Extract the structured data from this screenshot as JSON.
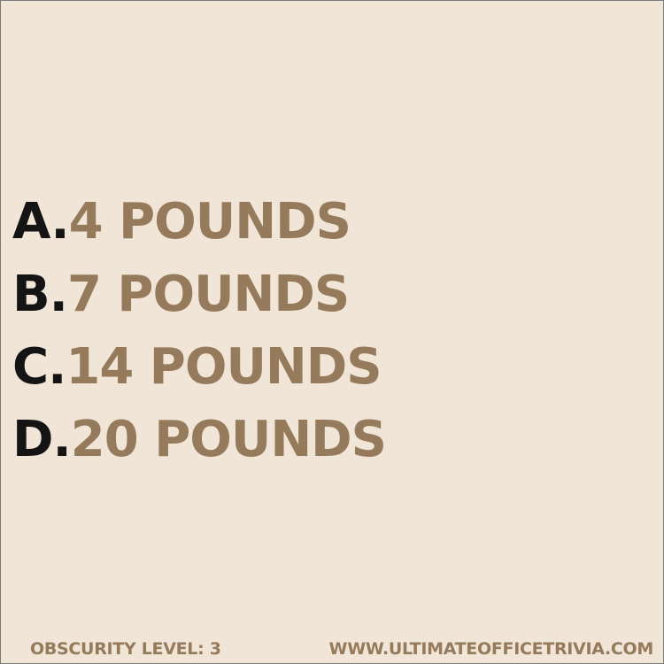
{
  "answers": [
    {
      "letter": "A.",
      "text": "4 POUNDS"
    },
    {
      "letter": "B.",
      "text": "7 POUNDS"
    },
    {
      "letter": "C.",
      "text": "14 POUNDS"
    },
    {
      "letter": "D.",
      "text": "20 POUNDS"
    }
  ],
  "footer": {
    "obscurity": "OBSCURITY LEVEL: 3",
    "website": "WWW.ULTIMATEOFFICETRIVIA.COM"
  },
  "colors": {
    "background": "#f1e5d8",
    "letter": "#141414",
    "answer_text": "#957a5b",
    "footer_text": "#957a5b"
  }
}
